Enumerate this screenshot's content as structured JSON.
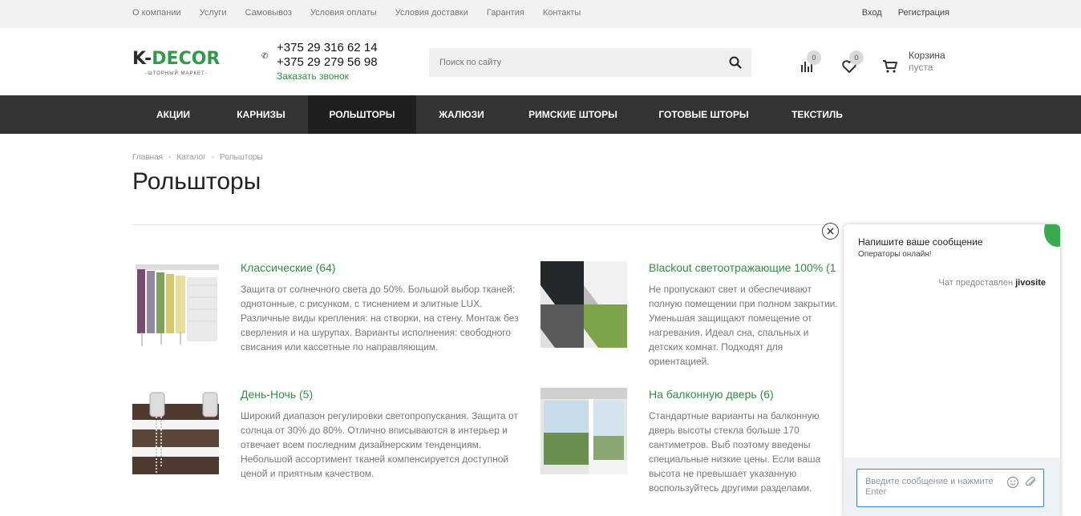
{
  "topbar": {
    "links": [
      "О компании",
      "Услуги",
      "Самовывоз",
      "Условия оплаты",
      "Условия доставки",
      "Гарантия",
      "Контакты"
    ],
    "login": "Вход",
    "register": "Регистрация"
  },
  "header": {
    "logo_k": "K-",
    "logo_decor": "DECOR",
    "logo_tagline": "-ШТОРНЫЙ МАРКЕТ-",
    "phone1": "+375 29 316 62 14",
    "phone2": "+375 29 279 56 98",
    "callback": "Заказать звонок",
    "search_placeholder": "Поиск по сайту",
    "compare_count": "0",
    "favorites_count": "0",
    "cart_title": "Корзина",
    "cart_status": "пуста"
  },
  "nav": {
    "items": [
      "Акции",
      "Карнизы",
      "Рольшторы",
      "Жалюзи",
      "Римские шторы",
      "Готовые шторы",
      "Текстиль"
    ],
    "active_index": 2
  },
  "breadcrumb": [
    "Главная",
    "Каталог",
    "Рольшторы"
  ],
  "page_title": "Рольшторы",
  "categories": [
    {
      "name": "Классические (64)",
      "desc": "Защита от солнечного света до 50%. Большой выбор тканей: однотонные, с рисунком, с тиснением и элитные LUX. Различные виды крепления: на створки, на стену. Монтаж без сверления и на шурупах. Варианты исполнения: свободного свисания или кассетные по направляющим."
    },
    {
      "name": "Blackout светоотражающие 100% (1",
      "desc": "Не пропускают свет и обеспечивают полную помещении при полном закрытии. Уменьшая защищают помещение от нагревания. Идеал сна, спальных и детских комнат. Подходят для ориентацией."
    },
    {
      "name": "День-Ночь (5)",
      "desc": "Широкий диапазон регулировки светопропускания. Защита от солнца от 30% до 80%. Отлично вписываются в интерьер и отвечает всем последним дизайнерским тенденциям. Небольшой ассортимент тканей компенсируется доступной ценой и приятным качеством."
    },
    {
      "name": "На балконную дверь (6)",
      "desc": "Стандартные варианты на балконную дверь высоты стекла больше 170 сантиметров. Выб поэтому введены специальные низкие цены. Если ваша высота не превышает указанную воспользуйтесь другими разделами."
    }
  ],
  "chat": {
    "title": "Напишите ваше сообщение",
    "subtitle": "Операторы онлайн!",
    "powered_by": "Чат предоставлен",
    "brand": "jivosite",
    "input_placeholder": "Введите сообщение и нажмите Enter"
  },
  "colors": {
    "accent_green": "#2f8f45",
    "nav_bg": "#333333",
    "nav_active": "#1f1f1f",
    "chat_border": "#2b87c5"
  }
}
